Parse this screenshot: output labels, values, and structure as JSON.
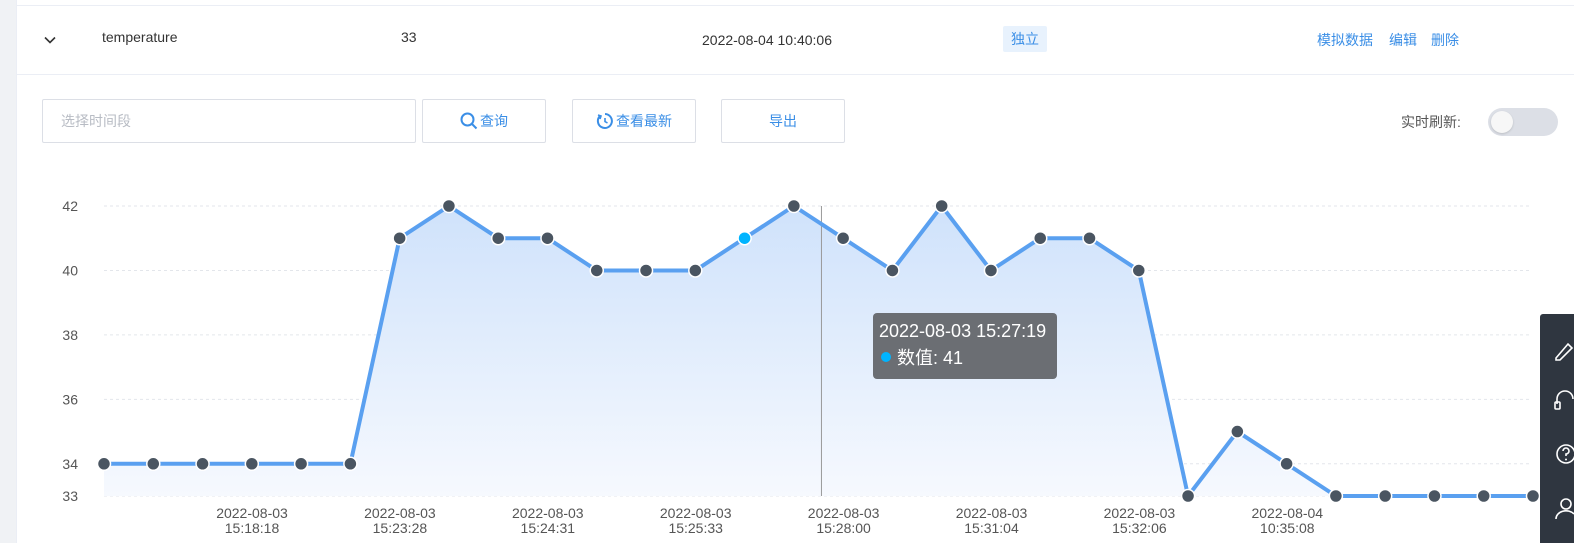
{
  "row": {
    "name": "temperature",
    "value": "33",
    "timestamp": "2022-08-04 10:40:06",
    "tag": "独立",
    "actions": {
      "simulate": "模拟数据",
      "edit": "编辑",
      "delete": "删除"
    }
  },
  "toolbar": {
    "date_placeholder": "选择时间段",
    "query_label": "查询",
    "latest_label": "查看最新",
    "export_label": "导出",
    "realtime_label": "实时刷新:",
    "realtime_on": false
  },
  "tooltip": {
    "time": "2022-08-03 15:27:19",
    "series_label": "数值: 41"
  },
  "colors": {
    "accent": "#3a8ee6",
    "line": "#5aa0f0",
    "point": "#4a5561",
    "highlight": "#00b4ff"
  },
  "sidebar_icons": [
    "edit-icon",
    "headset-icon",
    "help-icon",
    "user-icon"
  ],
  "chart_data": {
    "type": "line",
    "title": "",
    "xlabel": "",
    "ylabel": "",
    "ylim": [
      33,
      42
    ],
    "yticks": [
      33,
      34,
      36,
      38,
      40,
      42
    ],
    "grid": true,
    "area_fill": true,
    "x_tick_labels": [
      [
        "2022-08-03",
        "15:18:18"
      ],
      [
        "2022-08-03",
        "15:23:28"
      ],
      [
        "2022-08-03",
        "15:24:31"
      ],
      [
        "2022-08-03",
        "15:25:33"
      ],
      [
        "2022-08-03",
        "15:28:00"
      ],
      [
        "2022-08-03",
        "15:31:04"
      ],
      [
        "2022-08-03",
        "15:32:06"
      ],
      [
        "2022-08-04",
        "10:35:08"
      ]
    ],
    "values": [
      34,
      34,
      34,
      34,
      34,
      34,
      41,
      42,
      41,
      41,
      40,
      40,
      40,
      41,
      42,
      41,
      40,
      42,
      40,
      41,
      41,
      40,
      33,
      35,
      34,
      33,
      33,
      33,
      33,
      33
    ],
    "highlight_index": 13
  }
}
